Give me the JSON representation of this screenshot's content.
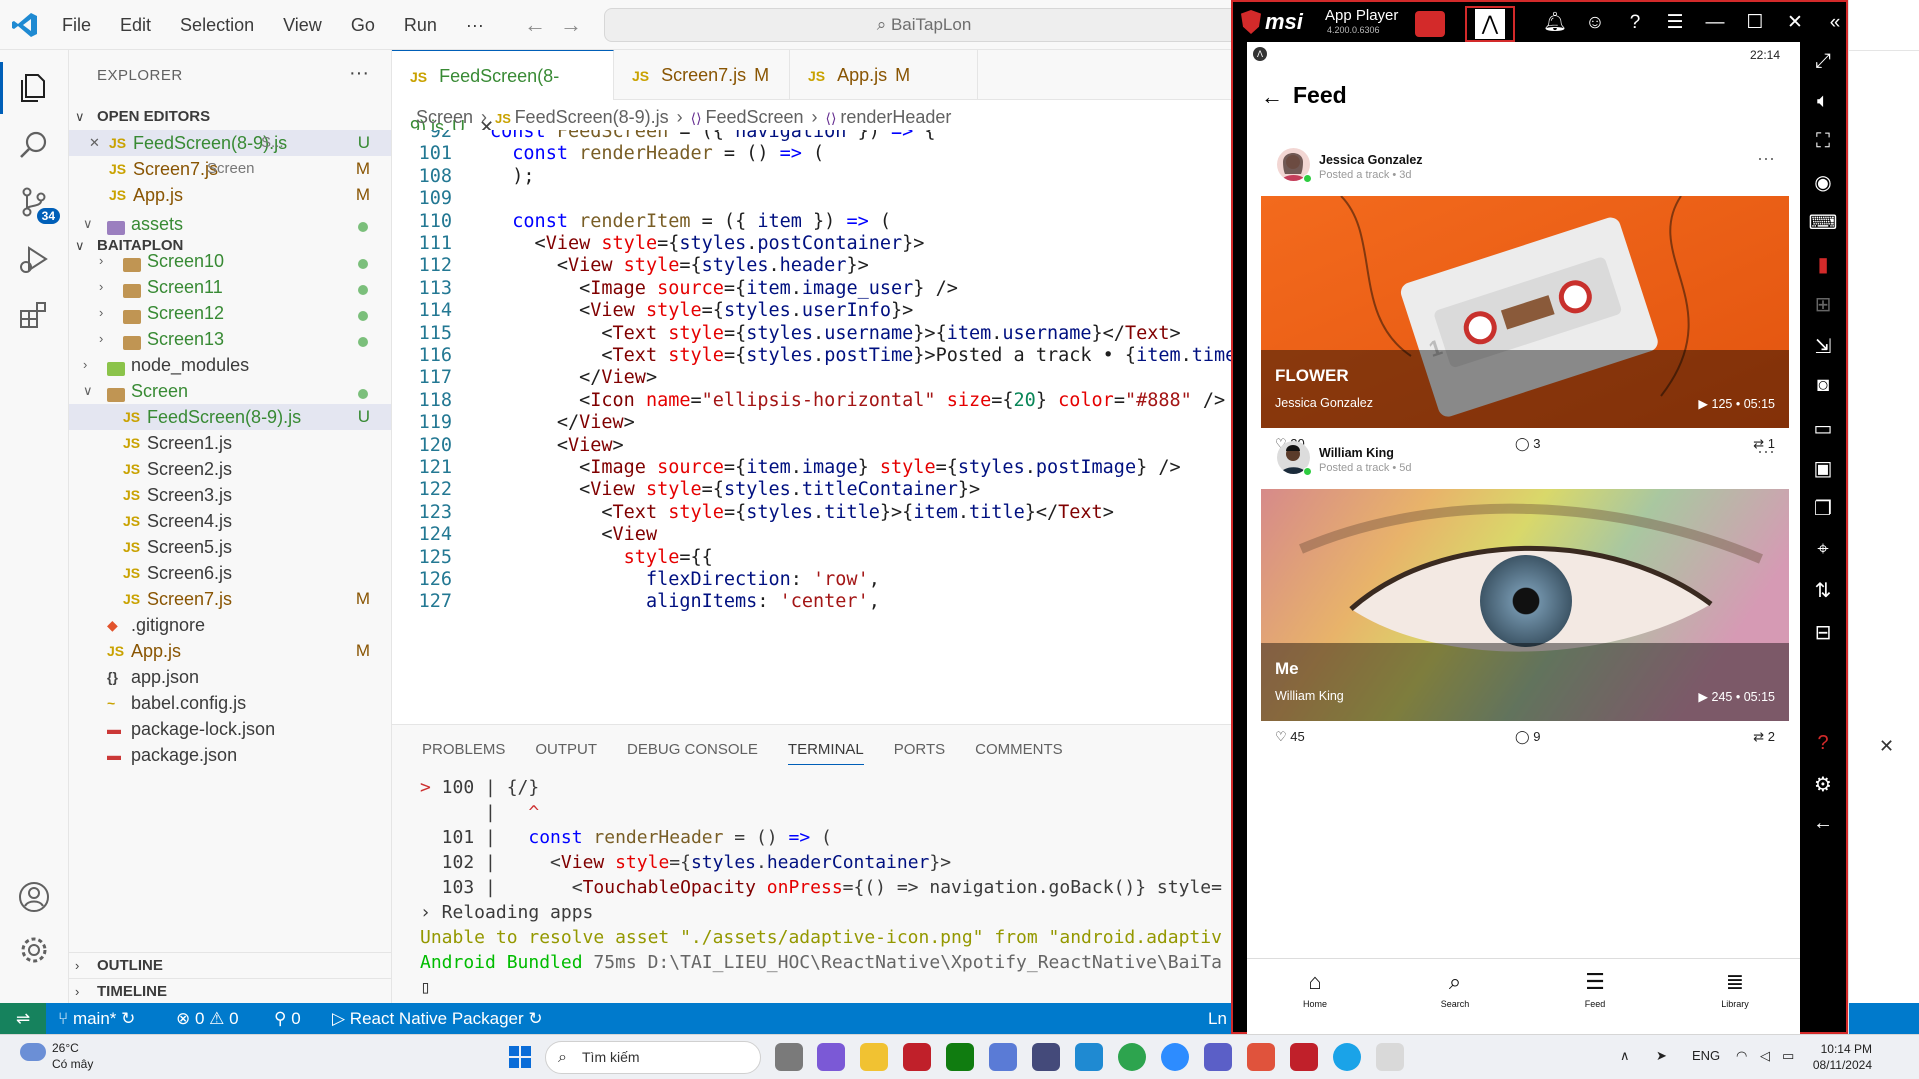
{
  "titlebar": {
    "menu": [
      "File",
      "Edit",
      "Selection",
      "View",
      "Go",
      "Run",
      "···"
    ],
    "search_text": "BaiTapLon"
  },
  "activity": {
    "scm_badge": "34"
  },
  "explorer": {
    "title": "EXPLORER",
    "open_editors_label": "OPEN EDITORS",
    "open_editors": [
      {
        "name": "FeedScreen(8-9).js",
        "suffix": "S...",
        "status": "U"
      },
      {
        "name": "Screen7.js",
        "suffix": "Screen",
        "status": "M"
      },
      {
        "name": "App.js",
        "suffix": "",
        "status": "M"
      }
    ],
    "project_label": "BAITAPLON",
    "tree": [
      {
        "name": "assets",
        "kind": "folder-open",
        "indent": 1,
        "status": "dot"
      },
      {
        "name": "Screen10",
        "kind": "folder",
        "indent": 2,
        "status": "dot"
      },
      {
        "name": "Screen11",
        "kind": "folder",
        "indent": 2,
        "status": "dot"
      },
      {
        "name": "Screen12",
        "kind": "folder",
        "indent": 2,
        "status": "dot"
      },
      {
        "name": "Screen13",
        "kind": "folder",
        "indent": 2,
        "status": "dot"
      },
      {
        "name": "node_modules",
        "kind": "folder",
        "indent": 1,
        "status": ""
      },
      {
        "name": "Screen",
        "kind": "folder-open",
        "indent": 1,
        "status": "dot"
      },
      {
        "name": "FeedScreen(8-9).js",
        "kind": "js",
        "indent": 2,
        "status": "U"
      },
      {
        "name": "Screen1.js",
        "kind": "js",
        "indent": 2,
        "status": ""
      },
      {
        "name": "Screen2.js",
        "kind": "js",
        "indent": 2,
        "status": ""
      },
      {
        "name": "Screen3.js",
        "kind": "js",
        "indent": 2,
        "status": ""
      },
      {
        "name": "Screen4.js",
        "kind": "js",
        "indent": 2,
        "status": ""
      },
      {
        "name": "Screen5.js",
        "kind": "js",
        "indent": 2,
        "status": ""
      },
      {
        "name": "Screen6.js",
        "kind": "js",
        "indent": 2,
        "status": ""
      },
      {
        "name": "Screen7.js",
        "kind": "js",
        "indent": 2,
        "status": "M"
      },
      {
        "name": ".gitignore",
        "kind": "git",
        "indent": 1,
        "status": ""
      },
      {
        "name": "App.js",
        "kind": "js",
        "indent": 1,
        "status": "M"
      },
      {
        "name": "app.json",
        "kind": "json",
        "indent": 1,
        "status": ""
      },
      {
        "name": "babel.config.js",
        "kind": "babel",
        "indent": 1,
        "status": ""
      },
      {
        "name": "package-lock.json",
        "kind": "npm",
        "indent": 1,
        "status": ""
      },
      {
        "name": "package.json",
        "kind": "npm",
        "indent": 1,
        "status": ""
      }
    ],
    "outline_label": "OUTLINE",
    "timeline_label": "TIMELINE"
  },
  "tabs": [
    {
      "name": "FeedScreen(8-9).js",
      "status": "U",
      "close": "✕"
    },
    {
      "name": "Screen7.js",
      "status": "M",
      "close": ""
    },
    {
      "name": "App.js",
      "status": "M",
      "close": ""
    }
  ],
  "breadcrumb": [
    "Screen",
    "FeedScreen(8-9).js",
    "FeedScreen",
    "renderHeader"
  ],
  "code_lines": [
    {
      "n": "92",
      "html": "<span class='k'>const</span> <span class='fn'>FeedScreen</span> = ({ <span class='v'>navigation</span> }) <span class='k'>=&gt;</span> {"
    },
    {
      "n": "101",
      "html": "  <span class='k'>const</span> <span class='fn'>renderHeader</span> = () <span class='k'>=&gt;</span> ("
    },
    {
      "n": "108",
      "html": "  );"
    },
    {
      "n": "109",
      "html": ""
    },
    {
      "n": "110",
      "html": "  <span class='k'>const</span> <span class='fn'>renderItem</span> = ({ <span class='v'>item</span> }) <span class='k'>=&gt;</span> ("
    },
    {
      "n": "111",
      "html": "    &lt;<span class='t'>View</span> <span class='a'>style</span>={<span class='v'>styles</span>.<span class='v'>postContainer</span>}&gt;"
    },
    {
      "n": "112",
      "html": "      &lt;<span class='t'>View</span> <span class='a'>style</span>={<span class='v'>styles</span>.<span class='v'>header</span>}&gt;"
    },
    {
      "n": "113",
      "html": "        &lt;<span class='t'>Image</span> <span class='a'>source</span>={<span class='v'>item</span>.<span class='v'>image_user</span>} /&gt;"
    },
    {
      "n": "114",
      "html": "        &lt;<span class='t'>View</span> <span class='a'>style</span>={<span class='v'>styles</span>.<span class='v'>userInfo</span>}&gt;"
    },
    {
      "n": "115",
      "html": "          &lt;<span class='t'>Text</span> <span class='a'>style</span>={<span class='v'>styles</span>.<span class='v'>username</span>}&gt;{<span class='v'>item</span>.<span class='v'>username</span>}&lt;/<span class='t'>Text</span>&gt;"
    },
    {
      "n": "116",
      "html": "          &lt;<span class='t'>Text</span> <span class='a'>style</span>={<span class='v'>styles</span>.<span class='v'>postTime</span>}&gt;Posted a track • {<span class='v'>item</span>.<span class='v'>time</span>"
    },
    {
      "n": "117",
      "html": "        &lt;/<span class='t'>View</span>&gt;"
    },
    {
      "n": "118",
      "html": "        &lt;<span class='t'>Icon</span> <span class='a'>name</span>=<span class='s'>\"ellipsis-horizontal\"</span> <span class='a'>size</span>={<span class='n'>20</span>} <span class='a'>color</span>=<span class='s'>\"#888\"</span> /&gt;"
    },
    {
      "n": "119",
      "html": "      &lt;/<span class='t'>View</span>&gt;"
    },
    {
      "n": "120",
      "html": "      &lt;<span class='t'>View</span>&gt;"
    },
    {
      "n": "121",
      "html": "        &lt;<span class='t'>Image</span> <span class='a'>source</span>={<span class='v'>item</span>.<span class='v'>image</span>} <span class='a'>style</span>={<span class='v'>styles</span>.<span class='v'>postImage</span>} /&gt;"
    },
    {
      "n": "122",
      "html": "        &lt;<span class='t'>View</span> <span class='a'>style</span>={<span class='v'>styles</span>.<span class='v'>titleContainer</span>}&gt;"
    },
    {
      "n": "123",
      "html": "          &lt;<span class='t'>Text</span> <span class='a'>style</span>={<span class='v'>styles</span>.<span class='v'>title</span>}&gt;{<span class='v'>item</span>.<span class='v'>title</span>}&lt;/<span class='t'>Text</span>&gt;"
    },
    {
      "n": "124",
      "html": "          &lt;<span class='t'>View</span>"
    },
    {
      "n": "125",
      "html": "            <span class='a'>style</span>={{"
    },
    {
      "n": "126",
      "html": "              <span class='v'>flexDirection</span>: <span class='s'>'row'</span>,"
    },
    {
      "n": "127",
      "html": "              <span class='v'>alignItems</span>: <span class='s'>'center'</span>,"
    }
  ],
  "panel": {
    "tabs": [
      "PROBLEMS",
      "OUTPUT",
      "DEBUG CONSOLE",
      "TERMINAL",
      "PORTS",
      "COMMENTS"
    ],
    "active": "TERMINAL",
    "terminal": [
      {
        "cls": "",
        "html": "<span class='red'>&gt;</span> 100 | {/}"
      },
      {
        "cls": "",
        "html": "      |   <span class='red'>^</span>"
      },
      {
        "cls": "",
        "html": "  101 |   <span class='k'>const</span> <span class='fn'>renderHeader</span> = () <span class='k'>=&gt;</span> ("
      },
      {
        "cls": "",
        "html": "  102 |     &lt;<span class='t'>View</span> <span class='a'>style</span>={<span class='v'>styles</span>.<span class='v'>headerContainer</span>}&gt;"
      },
      {
        "cls": "",
        "html": "  103 |       &lt;<span class='t'>TouchableOpacity</span> <span class='a'>onPress</span>={() =&gt; navigation.goBack()} style="
      },
      {
        "cls": "",
        "html": "› Reloading apps"
      },
      {
        "cls": "",
        "html": "<span class='yel'>Unable to resolve asset \"./assets/adaptive-icon.png\" from \"android.adaptiv</span>"
      },
      {
        "cls": "",
        "html": "<span class='grn'>Android Bundled</span> <span class='gry'>75ms D:\\TAI_LIEU_HOC\\ReactNative\\Xpotify_ReactNative\\BaiTa</span>"
      },
      {
        "cls": "",
        "html": "▯"
      }
    ]
  },
  "statusbar": {
    "branch": "main*",
    "errors": "⊗ 0 ⚠ 0",
    "ports": "0",
    "task": "React Native Packager",
    "position": "Ln"
  },
  "player": {
    "brand": "msi",
    "app_name": "App Player",
    "version": "4.200.0.6306",
    "phone_time": "22:14",
    "screen_title": "Feed",
    "posts": [
      {
        "username": "Jessica Gonzalez",
        "post_time": "Posted a track • 3d",
        "title": "FLOWER",
        "artist": "Jessica Gonzalez",
        "plays": "125",
        "duration": "05:15",
        "likes": "20",
        "comments": "3",
        "reposts": "1"
      },
      {
        "username": "William King",
        "post_time": "Posted a track • 5d",
        "title": "Me",
        "artist": "William King",
        "plays": "245",
        "duration": "05:15",
        "likes": "45",
        "comments": "9",
        "reposts": "2"
      }
    ],
    "nav": [
      "Home",
      "Search",
      "Feed",
      "Library"
    ]
  },
  "taskbar": {
    "temp": "26°C",
    "weather": "Có mây",
    "search": "Tìm kiếm",
    "lang": "ENG",
    "time": "10:14 PM",
    "date": "08/11/2024"
  },
  "colors": {
    "accent": "#005fb8",
    "statusbar": "#007acc",
    "player_border": "#d32a2a"
  }
}
